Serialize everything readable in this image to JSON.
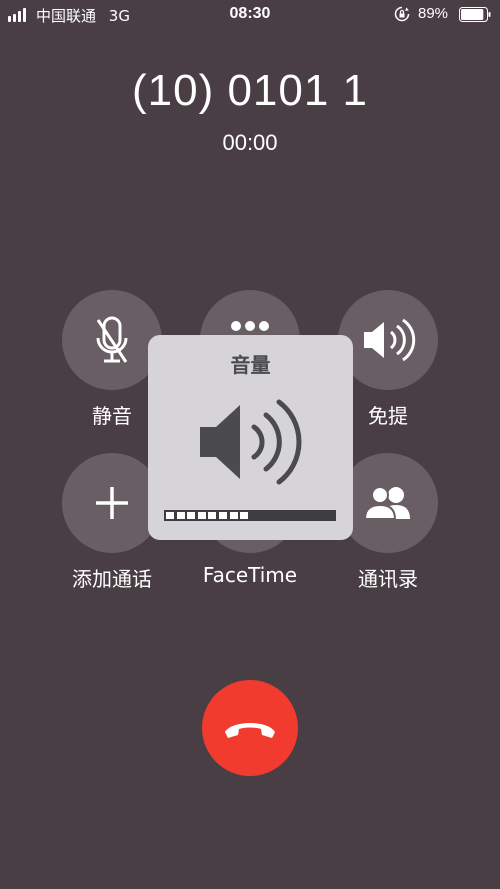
{
  "status_bar": {
    "carrier": "中国联通",
    "network": "3G",
    "time": "08:30",
    "battery_percent": "89%",
    "battery_level": 0.89,
    "signal_bars": 4
  },
  "call": {
    "number": "(10) 0101 1",
    "duration": "00:00"
  },
  "buttons": {
    "mute": {
      "label": "静音",
      "icon": "mic-muted-icon"
    },
    "keypad": {
      "label": "",
      "icon": "keypad-icon"
    },
    "speaker": {
      "label": "免提",
      "icon": "speaker-icon"
    },
    "add_call": {
      "label": "添加通话",
      "icon": "plus-icon"
    },
    "facetime": {
      "label": "FaceTime",
      "icon": "facetime-icon"
    },
    "contacts": {
      "label": "通讯录",
      "icon": "contacts-icon"
    },
    "end_call": {
      "icon": "phone-hangup-icon"
    }
  },
  "volume_hud": {
    "title": "音量",
    "level_segments": 8,
    "total_segments": 16
  },
  "colors": {
    "background": "#4a3e45",
    "end_call": "#f13b2f",
    "hud": "#d6d4d8"
  }
}
